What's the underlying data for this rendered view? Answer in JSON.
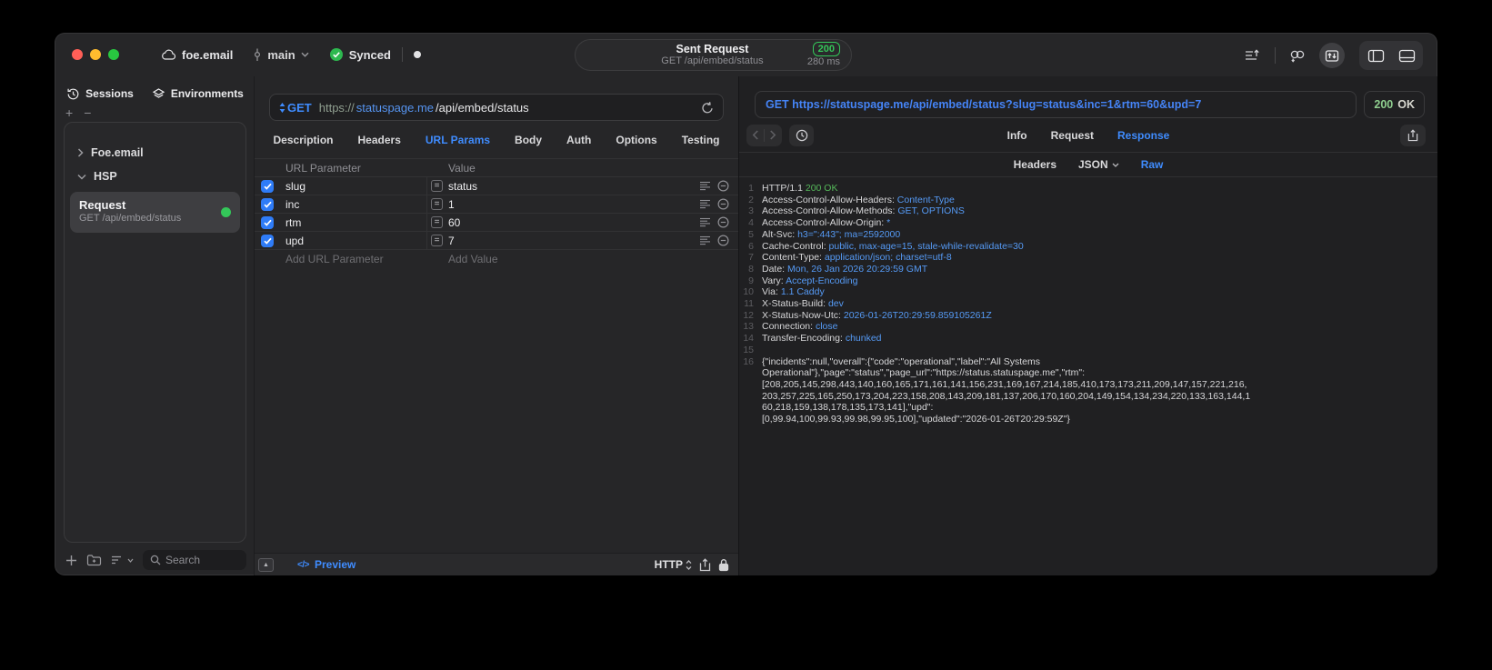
{
  "titlebar": {
    "project": "foe.email",
    "branch": "main",
    "sync_status": "Synced",
    "sent_pill": {
      "title": "Sent Request",
      "subtitle": "GET /api/embed/status",
      "status_code": "200",
      "duration": "280 ms"
    }
  },
  "sidebar": {
    "tabs": [
      {
        "label": "Sessions",
        "icon": "history-icon"
      },
      {
        "label": "Environments",
        "icon": "layers-icon"
      }
    ],
    "groups": [
      {
        "label": "Foe.email",
        "state": "collapsed"
      },
      {
        "label": "HSP",
        "state": "expanded"
      }
    ],
    "request_item": {
      "title": "Request",
      "subtitle": "GET /api/embed/status"
    },
    "search": {
      "placeholder": "Search"
    }
  },
  "request_editor": {
    "method": "GET",
    "url": {
      "scheme": "https://",
      "host": "statuspage.me",
      "path": "/api/embed/status"
    },
    "tabs": [
      "Description",
      "Headers",
      "URL Params",
      "Body",
      "Auth",
      "Options",
      "Testing"
    ],
    "active_tab": "URL Params",
    "params": {
      "name_header": "URL Parameter",
      "value_header": "Value",
      "rows": [
        {
          "enabled": true,
          "name": "slug",
          "operator": "=",
          "value": "status"
        },
        {
          "enabled": true,
          "name": "inc",
          "operator": "=",
          "value": "1"
        },
        {
          "enabled": true,
          "name": "rtm",
          "operator": "=",
          "value": "60"
        },
        {
          "enabled": true,
          "name": "upd",
          "operator": "=",
          "value": "7"
        }
      ],
      "add_name_placeholder": "Add URL Parameter",
      "add_value_placeholder": "Add Value"
    },
    "footer": {
      "preview_label": "Preview",
      "protocol_label": "HTTP"
    }
  },
  "response_viewer": {
    "request_line": "GET https://statuspage.me/api/embed/status?slug=status&inc=1&rtm=60&upd=7",
    "status_code": "200",
    "status_text": "OK",
    "tabs": [
      "Info",
      "Request",
      "Response"
    ],
    "active_tab": "Response",
    "view_modes": [
      "Headers",
      "JSON",
      "Raw"
    ],
    "active_view": "Raw",
    "code_lines": [
      [
        [
          "plain",
          "HTTP/1.1 "
        ],
        [
          "green",
          "200 OK"
        ]
      ],
      [
        [
          "plain",
          "Access-Control-Allow-Headers: "
        ],
        [
          "blue",
          "Content-Type"
        ]
      ],
      [
        [
          "plain",
          "Access-Control-Allow-Methods: "
        ],
        [
          "blue",
          "GET, OPTIONS"
        ]
      ],
      [
        [
          "plain",
          "Access-Control-Allow-Origin: "
        ],
        [
          "blue",
          "*"
        ]
      ],
      [
        [
          "plain",
          "Alt-Svc: "
        ],
        [
          "blue",
          "h3=\":443\"; ma=2592000"
        ]
      ],
      [
        [
          "plain",
          "Cache-Control: "
        ],
        [
          "blue",
          "public, max-age=15, stale-while-revalidate=30"
        ]
      ],
      [
        [
          "plain",
          "Content-Type: "
        ],
        [
          "blue",
          "application/json; charset=utf-8"
        ]
      ],
      [
        [
          "plain",
          "Date: "
        ],
        [
          "blue",
          "Mon, 26 Jan 2026 20:29:59 GMT"
        ]
      ],
      [
        [
          "plain",
          "Vary: "
        ],
        [
          "blue",
          "Accept-Encoding"
        ]
      ],
      [
        [
          "plain",
          "Via: "
        ],
        [
          "blue",
          "1.1 Caddy"
        ]
      ],
      [
        [
          "plain",
          "X-Status-Build: "
        ],
        [
          "blue",
          "dev"
        ]
      ],
      [
        [
          "plain",
          "X-Status-Now-Utc: "
        ],
        [
          "blue",
          "2026-01-26T20:29:59.859105261Z"
        ]
      ],
      [
        [
          "plain",
          "Connection: "
        ],
        [
          "blue",
          "close"
        ]
      ],
      [
        [
          "plain",
          "Transfer-Encoding: "
        ],
        [
          "blue",
          "chunked"
        ]
      ],
      []
    ],
    "body_first_line_number": "16",
    "body_lines": [
      "{\"incidents\":null,\"overall\":{\"code\":\"operational\",\"label\":\"All Systems",
      "Operational\"},\"page\":\"status\",\"page_url\":\"https://status.statuspage.me\",\"rtm\":",
      "[208,205,145,298,443,140,160,165,171,161,141,156,231,169,167,214,185,410,173,173,211,209,147,157,221,216,",
      "203,257,225,165,250,173,204,223,158,208,143,209,181,137,206,170,160,204,149,154,134,234,220,133,163,144,1",
      "60,218,159,138,178,135,173,141],\"upd\":",
      "[0,99.94,100,99.93,99.98,99.95,100],\"updated\":\"2026-01-26T20:29:59Z\"}"
    ]
  }
}
